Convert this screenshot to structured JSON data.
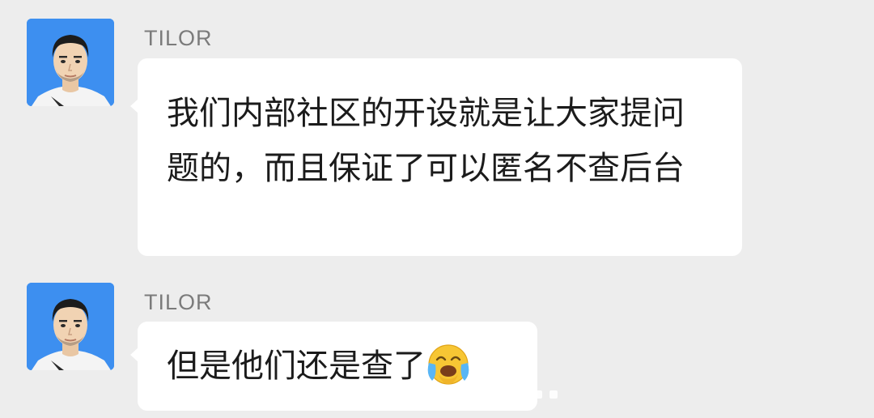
{
  "conversation": {
    "messages": [
      {
        "sender": "TILOR",
        "text": "我们内部社区的开设就是让大家提问题的，而且保证了可以匿名不查后台"
      },
      {
        "sender": "TILOR",
        "text": "但是他们还是查了",
        "emoji": "crying-face-emoji"
      }
    ]
  },
  "colors": {
    "background": "#ededed",
    "bubble": "#ffffff",
    "avatar_bg": "#3d8ff0",
    "sender_name": "#7b7b7b",
    "message_text": "#1b1b1b"
  }
}
